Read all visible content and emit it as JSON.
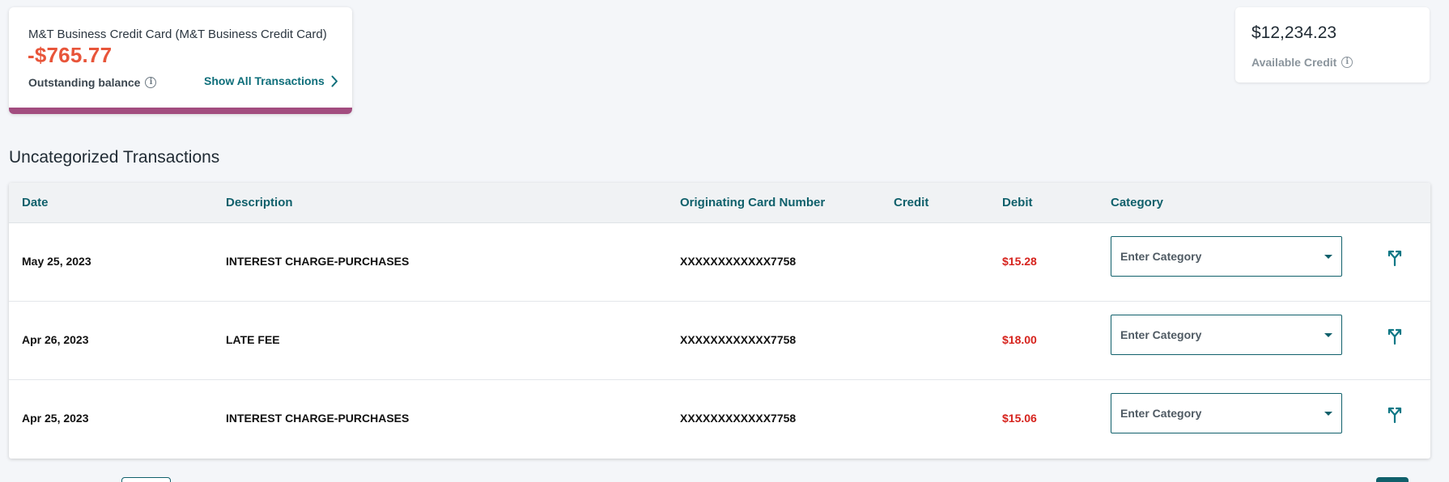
{
  "account": {
    "name": "M&T Business Credit Card (M&T Business Credit Card)",
    "balance": "-$765.77",
    "balance_label": "Outstanding balance",
    "show_all_label": "Show All Transactions",
    "accent_color": "#a24d7f",
    "balance_color": "#e8553a"
  },
  "available_credit": {
    "amount": "$12,234.23",
    "label": "Available Credit"
  },
  "section_title": "Uncategorized Transactions",
  "table": {
    "columns": {
      "date": "Date",
      "description": "Description",
      "card": "Originating Card Number",
      "credit": "Credit",
      "debit": "Debit",
      "category": "Category"
    },
    "category_placeholder": "Enter Category",
    "rows": [
      {
        "date": "May 25, 2023",
        "description": "INTEREST CHARGE-PURCHASES",
        "card": "XXXXXXXXXXXX7758",
        "credit": "",
        "debit": "$15.28"
      },
      {
        "date": "Apr 26, 2023",
        "description": "LATE FEE",
        "card": "XXXXXXXXXXXX7758",
        "credit": "",
        "debit": "$18.00"
      },
      {
        "date": "Apr 25, 2023",
        "description": "INTEREST CHARGE-PURCHASES",
        "card": "XXXXXXXXXXXX7758",
        "credit": "",
        "debit": "$15.06"
      }
    ],
    "header_color": "#10606b",
    "debit_color": "#d6231d"
  },
  "icons": {
    "info": "info-icon",
    "chevron": "chevron-right-icon",
    "split": "split-transaction-icon",
    "dropdown": "caret-down-icon"
  }
}
